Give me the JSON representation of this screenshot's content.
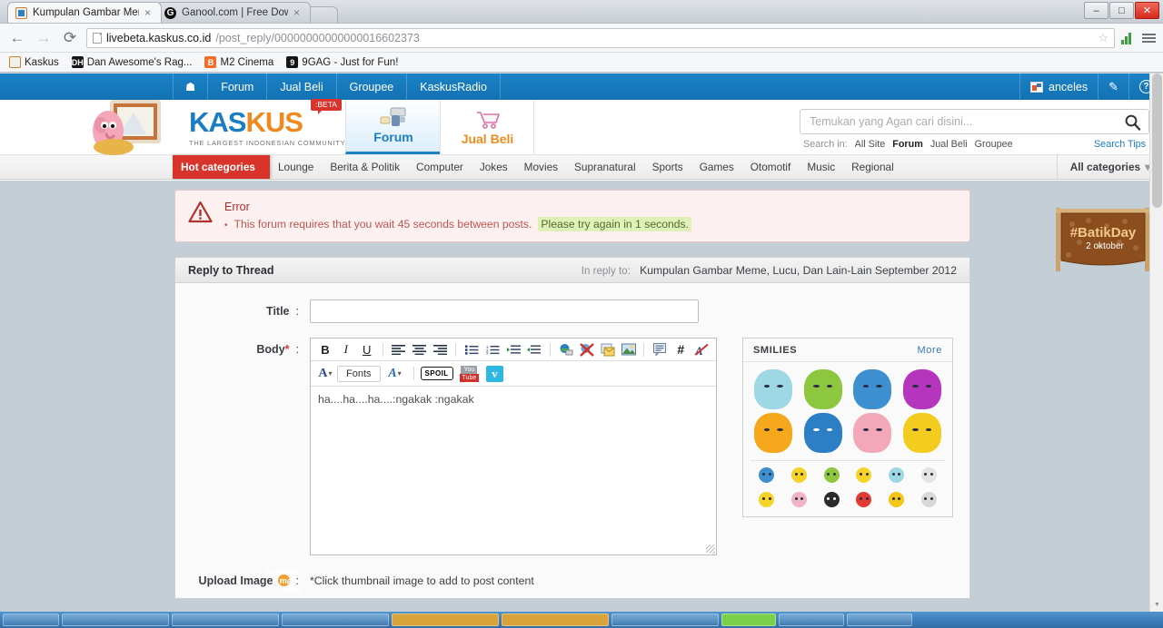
{
  "browser": {
    "tabs": [
      {
        "title": "Kumpulan Gambar Meme,",
        "favicon": "kaskus-icon",
        "active": true
      },
      {
        "title": "Ganool.com | Free Downlo",
        "favicon": "ganool-icon",
        "active": false
      }
    ],
    "new_tab_label": "",
    "window_controls": {
      "minimize": "–",
      "maximize": "□",
      "close": "✕"
    },
    "nav": {
      "back": "←",
      "forward": "→",
      "reload": "⟳"
    },
    "url": {
      "host": "livebeta.kaskus.co.id",
      "path": "/post_reply/00000000000000016602373"
    },
    "bookmarks": [
      {
        "label": "Kaskus",
        "icon": "kaskus-icon",
        "color": "#f0f0f0"
      },
      {
        "label": "Dan Awesome's Rag...",
        "icon": "ragemaker-icon",
        "color": "#1a1a1a"
      },
      {
        "label": "M2 Cinema",
        "icon": "blogger-icon",
        "color": "#f26c2a"
      },
      {
        "label": "9GAG - Just for Fun!",
        "icon": "ninegag-icon",
        "color": "#1a1a1a"
      }
    ]
  },
  "topbar": {
    "home_icon": "home-icon",
    "links": [
      "Forum",
      "Jual Beli",
      "Groupee",
      "KaskusRadio"
    ],
    "username": "anceles",
    "compose_icon": "pencil-icon",
    "help_icon": "question-mark-icon"
  },
  "logo": {
    "mascot": "kaskus-elephant-mascot",
    "name_part1": "KAS",
    "name_part2": "KUS",
    "tagline": "THE LARGEST INDONESIAN COMMUNITY",
    "beta_badge": ":BETA",
    "tabs": [
      {
        "label": "Forum",
        "icon": "forum-icon",
        "active": true
      },
      {
        "label": "Jual Beli",
        "icon": "shopping-cart-icon",
        "active": false
      }
    ]
  },
  "search": {
    "placeholder": "Temukan yang Agan cari disini...",
    "value": "",
    "search_icon": "search-icon",
    "in_label": "Search in:",
    "scopes": [
      {
        "label": "All Site",
        "selected": false
      },
      {
        "label": "Forum",
        "selected": true
      },
      {
        "label": "Jual Beli",
        "selected": false
      },
      {
        "label": "Groupee",
        "selected": false
      }
    ],
    "tips_label": "Search Tips"
  },
  "categories": {
    "hot_label": "Hot categories",
    "items": [
      "Lounge",
      "Berita & Politik",
      "Computer",
      "Jokes",
      "Movies",
      "Supranatural",
      "Sports",
      "Games",
      "Otomotif",
      "Music",
      "Regional"
    ],
    "all_label": "All categories",
    "all_caret": "▾"
  },
  "banner": {
    "title": "#BatikDay",
    "subtitle": "2 oktober"
  },
  "error": {
    "icon": "warning-triangle-icon",
    "title": "Error",
    "bullet": "•",
    "message": "This forum requires that you wait 45 seconds between posts.",
    "highlight": "Please try again in 1 seconds."
  },
  "form": {
    "panel_title": "Reply to Thread",
    "in_reply_to_label": "In reply to:",
    "thread_title": "Kumpulan Gambar Meme, Lucu, Dan Lain-Lain September 2012",
    "title_label": "Title",
    "title_value": "",
    "colon": ":",
    "body_label": "Body",
    "body_required": "*",
    "body_value": "ha....ha....ha....:ngakak :ngakak",
    "upload_label": "Upload Image",
    "upload_help_icon": "question-mark-icon",
    "upload_note": "*Click thumbnail image to add to post content"
  },
  "toolbar": {
    "row1": [
      {
        "name": "bold-icon",
        "glyph": "B"
      },
      {
        "name": "italic-icon",
        "glyph": "I"
      },
      {
        "name": "underline-icon",
        "glyph": "U"
      },
      {
        "name": "align-left-icon",
        "glyph": "≡"
      },
      {
        "name": "align-center-icon",
        "glyph": "≡"
      },
      {
        "name": "align-right-icon",
        "glyph": "≡"
      },
      {
        "name": "bullet-list-icon",
        "glyph": "☰"
      },
      {
        "name": "numbered-list-icon",
        "glyph": "☰"
      },
      {
        "name": "indent-icon",
        "glyph": "⇥"
      },
      {
        "name": "outdent-icon",
        "glyph": "⇤"
      },
      {
        "name": "insert-link-icon",
        "glyph": "●"
      },
      {
        "name": "remove-link-icon",
        "glyph": "✕"
      },
      {
        "name": "insert-email-icon",
        "glyph": "✉"
      },
      {
        "name": "insert-image-icon",
        "glyph": "▣"
      },
      {
        "name": "quote-icon",
        "glyph": "▤"
      },
      {
        "name": "code-icon",
        "glyph": "#"
      },
      {
        "name": "remove-format-icon",
        "glyph": "✘"
      }
    ],
    "row2": {
      "text_color_label": "A",
      "caret": "▾",
      "fonts_label": "Fonts",
      "font_size_label": "A",
      "spoil_label": "SPOIL",
      "youtube_label": "You",
      "youtube_sub": "Tube",
      "vimeo_label": "v"
    }
  },
  "smilies": {
    "title": "SMILIES",
    "more_label": "More",
    "large": [
      {
        "name": "smiley-bingung",
        "color": "#9ed8e4",
        "accent": "#d94a3a"
      },
      {
        "name": "smiley-najis",
        "color": "#8dc63f",
        "accent": "#6b2f8f"
      },
      {
        "name": "smiley-makan",
        "color": "#3d8fd0",
        "accent": "#d7df23"
      },
      {
        "name": "smiley-hammer",
        "color": "#b535bd",
        "accent": "#f2c14a"
      },
      {
        "name": "smiley-ngakak",
        "color": "#f5a81c",
        "accent": "#c8232c"
      },
      {
        "name": "smiley-nangis",
        "color": "#2c7fc4",
        "accent": "#ffffff"
      },
      {
        "name": "smiley-malu",
        "color": "#f2a8b8",
        "accent": "#e06c8a"
      },
      {
        "name": "smiley-berduka",
        "color": "#f2cc1e",
        "accent": "#d9a21a"
      }
    ],
    "small_row1": [
      {
        "name": "smiley-ngopi",
        "color": "#3d8fd0"
      },
      {
        "name": "smiley-matabelo",
        "color": "#f5d328"
      },
      {
        "name": "smiley-kimpoi",
        "color": "#8dc63f"
      },
      {
        "name": "smiley-genit",
        "color": "#f5d328"
      },
      {
        "name": "smiley-alarm",
        "color": "#9ed8e4"
      },
      {
        "name": "smiley-bendera",
        "color": "#e4e4e4"
      }
    ],
    "small_row2": [
      {
        "name": "smiley-kaget",
        "color": "#f5d328"
      },
      {
        "name": "smiley-babi",
        "color": "#f2b3c4"
      },
      {
        "name": "smiley-mawar",
        "color": "#2b2b2b"
      },
      {
        "name": "smiley-marah",
        "color": "#e33b33"
      },
      {
        "name": "smiley-cium",
        "color": "#f5c518"
      },
      {
        "name": "smiley-zzz",
        "color": "#d8d8d8"
      }
    ]
  },
  "colors": {
    "kaskus_blue": "#1b82c6",
    "kaskus_orange": "#f08a1e",
    "hot_red": "#d9342b",
    "error_bg": "#fdf0f1",
    "highlight_green": "#dff0b8"
  }
}
